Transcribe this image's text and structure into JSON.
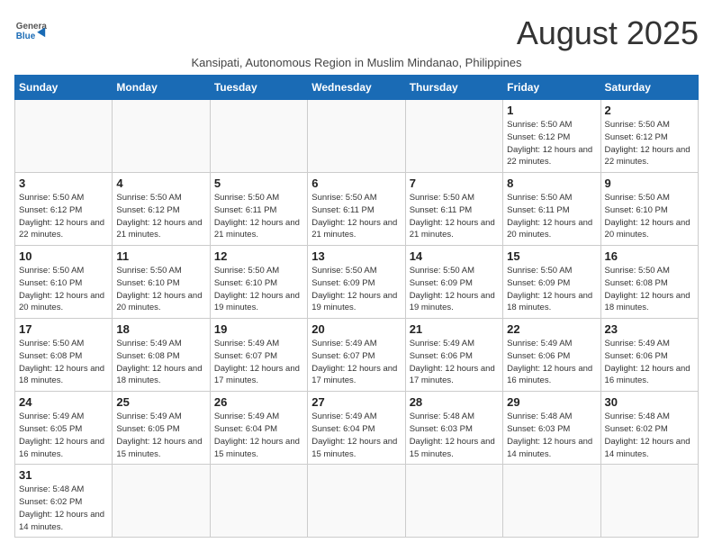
{
  "header": {
    "logo_line1": "General",
    "logo_line2": "Blue",
    "month_year": "August 2025",
    "subtitle": "Kansipati, Autonomous Region in Muslim Mindanao, Philippines"
  },
  "weekdays": [
    "Sunday",
    "Monday",
    "Tuesday",
    "Wednesday",
    "Thursday",
    "Friday",
    "Saturday"
  ],
  "weeks": [
    [
      {
        "day": "",
        "info": ""
      },
      {
        "day": "",
        "info": ""
      },
      {
        "day": "",
        "info": ""
      },
      {
        "day": "",
        "info": ""
      },
      {
        "day": "",
        "info": ""
      },
      {
        "day": "1",
        "info": "Sunrise: 5:50 AM\nSunset: 6:12 PM\nDaylight: 12 hours\nand 22 minutes."
      },
      {
        "day": "2",
        "info": "Sunrise: 5:50 AM\nSunset: 6:12 PM\nDaylight: 12 hours\nand 22 minutes."
      }
    ],
    [
      {
        "day": "3",
        "info": "Sunrise: 5:50 AM\nSunset: 6:12 PM\nDaylight: 12 hours\nand 22 minutes."
      },
      {
        "day": "4",
        "info": "Sunrise: 5:50 AM\nSunset: 6:12 PM\nDaylight: 12 hours\nand 21 minutes."
      },
      {
        "day": "5",
        "info": "Sunrise: 5:50 AM\nSunset: 6:11 PM\nDaylight: 12 hours\nand 21 minutes."
      },
      {
        "day": "6",
        "info": "Sunrise: 5:50 AM\nSunset: 6:11 PM\nDaylight: 12 hours\nand 21 minutes."
      },
      {
        "day": "7",
        "info": "Sunrise: 5:50 AM\nSunset: 6:11 PM\nDaylight: 12 hours\nand 21 minutes."
      },
      {
        "day": "8",
        "info": "Sunrise: 5:50 AM\nSunset: 6:11 PM\nDaylight: 12 hours\nand 20 minutes."
      },
      {
        "day": "9",
        "info": "Sunrise: 5:50 AM\nSunset: 6:10 PM\nDaylight: 12 hours\nand 20 minutes."
      }
    ],
    [
      {
        "day": "10",
        "info": "Sunrise: 5:50 AM\nSunset: 6:10 PM\nDaylight: 12 hours\nand 20 minutes."
      },
      {
        "day": "11",
        "info": "Sunrise: 5:50 AM\nSunset: 6:10 PM\nDaylight: 12 hours\nand 20 minutes."
      },
      {
        "day": "12",
        "info": "Sunrise: 5:50 AM\nSunset: 6:10 PM\nDaylight: 12 hours\nand 19 minutes."
      },
      {
        "day": "13",
        "info": "Sunrise: 5:50 AM\nSunset: 6:09 PM\nDaylight: 12 hours\nand 19 minutes."
      },
      {
        "day": "14",
        "info": "Sunrise: 5:50 AM\nSunset: 6:09 PM\nDaylight: 12 hours\nand 19 minutes."
      },
      {
        "day": "15",
        "info": "Sunrise: 5:50 AM\nSunset: 6:09 PM\nDaylight: 12 hours\nand 18 minutes."
      },
      {
        "day": "16",
        "info": "Sunrise: 5:50 AM\nSunset: 6:08 PM\nDaylight: 12 hours\nand 18 minutes."
      }
    ],
    [
      {
        "day": "17",
        "info": "Sunrise: 5:50 AM\nSunset: 6:08 PM\nDaylight: 12 hours\nand 18 minutes."
      },
      {
        "day": "18",
        "info": "Sunrise: 5:49 AM\nSunset: 6:08 PM\nDaylight: 12 hours\nand 18 minutes."
      },
      {
        "day": "19",
        "info": "Sunrise: 5:49 AM\nSunset: 6:07 PM\nDaylight: 12 hours\nand 17 minutes."
      },
      {
        "day": "20",
        "info": "Sunrise: 5:49 AM\nSunset: 6:07 PM\nDaylight: 12 hours\nand 17 minutes."
      },
      {
        "day": "21",
        "info": "Sunrise: 5:49 AM\nSunset: 6:06 PM\nDaylight: 12 hours\nand 17 minutes."
      },
      {
        "day": "22",
        "info": "Sunrise: 5:49 AM\nSunset: 6:06 PM\nDaylight: 12 hours\nand 16 minutes."
      },
      {
        "day": "23",
        "info": "Sunrise: 5:49 AM\nSunset: 6:06 PM\nDaylight: 12 hours\nand 16 minutes."
      }
    ],
    [
      {
        "day": "24",
        "info": "Sunrise: 5:49 AM\nSunset: 6:05 PM\nDaylight: 12 hours\nand 16 minutes."
      },
      {
        "day": "25",
        "info": "Sunrise: 5:49 AM\nSunset: 6:05 PM\nDaylight: 12 hours\nand 15 minutes."
      },
      {
        "day": "26",
        "info": "Sunrise: 5:49 AM\nSunset: 6:04 PM\nDaylight: 12 hours\nand 15 minutes."
      },
      {
        "day": "27",
        "info": "Sunrise: 5:49 AM\nSunset: 6:04 PM\nDaylight: 12 hours\nand 15 minutes."
      },
      {
        "day": "28",
        "info": "Sunrise: 5:48 AM\nSunset: 6:03 PM\nDaylight: 12 hours\nand 15 minutes."
      },
      {
        "day": "29",
        "info": "Sunrise: 5:48 AM\nSunset: 6:03 PM\nDaylight: 12 hours\nand 14 minutes."
      },
      {
        "day": "30",
        "info": "Sunrise: 5:48 AM\nSunset: 6:02 PM\nDaylight: 12 hours\nand 14 minutes."
      }
    ],
    [
      {
        "day": "31",
        "info": "Sunrise: 5:48 AM\nSunset: 6:02 PM\nDaylight: 12 hours\nand 14 minutes."
      },
      {
        "day": "",
        "info": ""
      },
      {
        "day": "",
        "info": ""
      },
      {
        "day": "",
        "info": ""
      },
      {
        "day": "",
        "info": ""
      },
      {
        "day": "",
        "info": ""
      },
      {
        "day": "",
        "info": ""
      }
    ]
  ]
}
